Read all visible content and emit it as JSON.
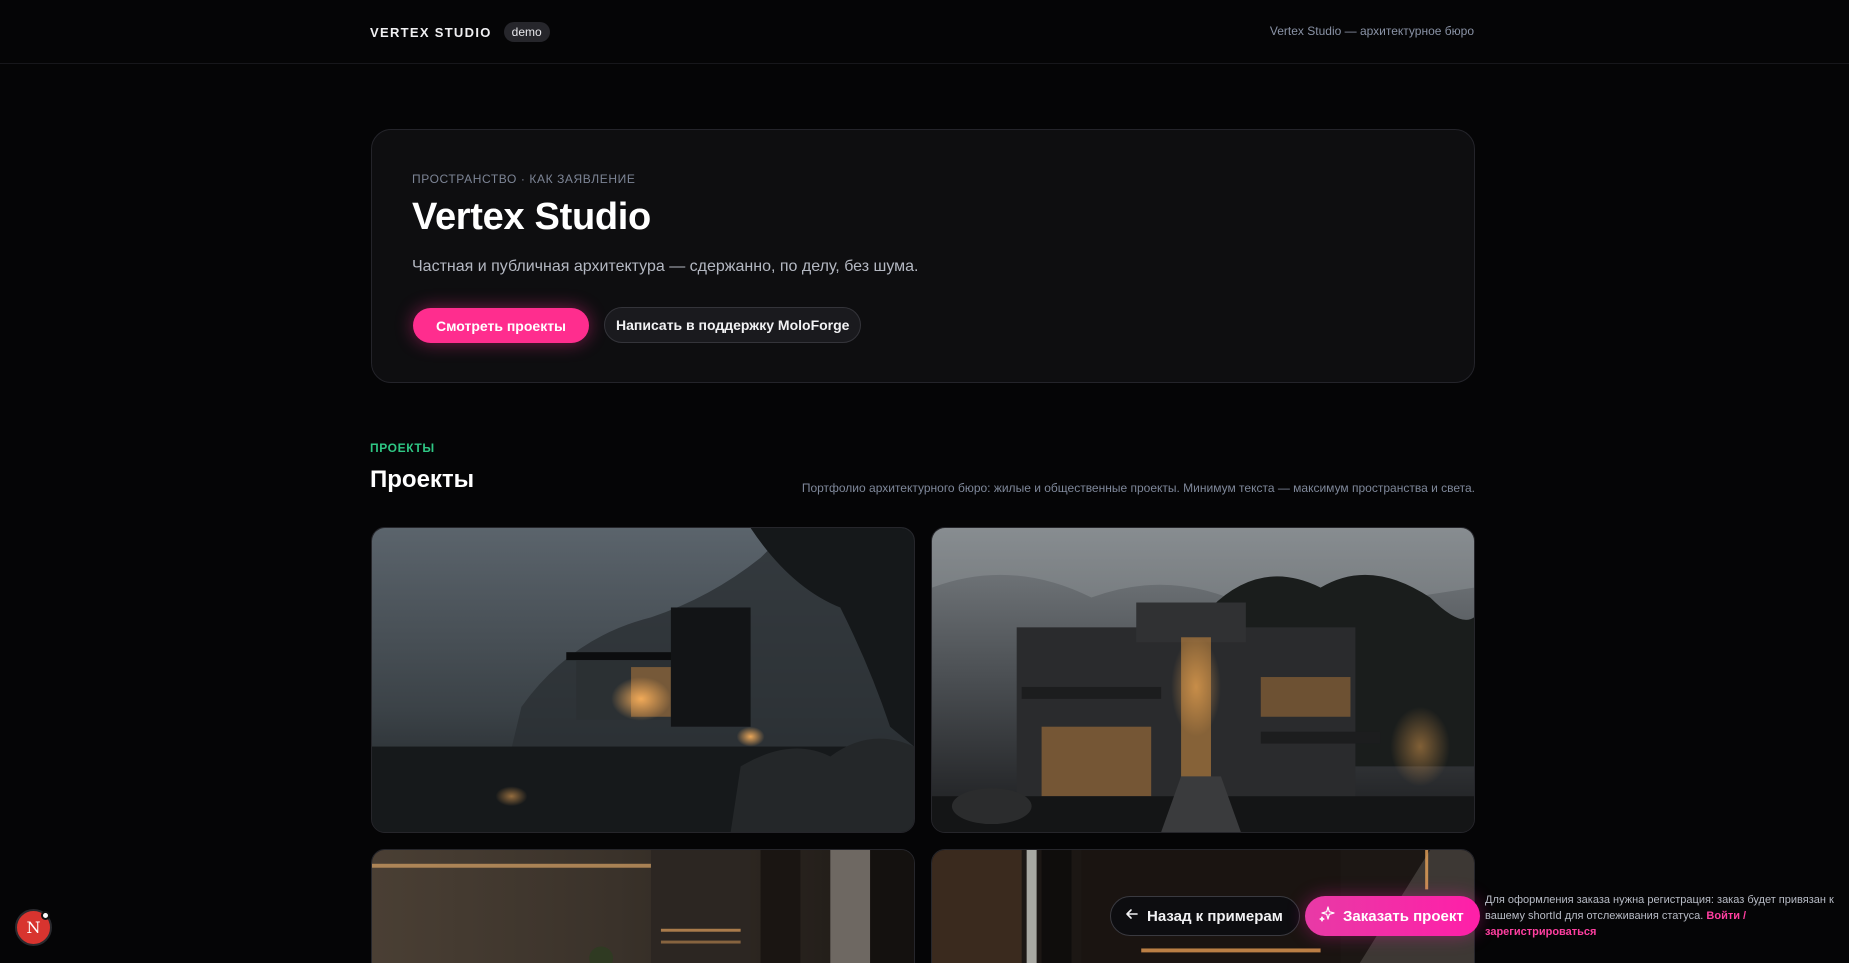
{
  "header": {
    "brand": "VERTEX STUDIO",
    "badge": "demo",
    "tagline": "Vertex Studio — архитектурное бюро"
  },
  "hero": {
    "kicker": "ПРОСТРАНСТВО · КАК ЗАЯВЛЕНИЕ",
    "title": "Vertex Studio",
    "subtitle": "Частная и публичная архитектура — сдержанно, по делу, без шума.",
    "primary_cta": "Смотреть проекты",
    "secondary_cta": "Написать в поддержку MoloForge"
  },
  "projects": {
    "kicker": "ПРОЕКТЫ",
    "title": "Проекты",
    "description": "Портфолио архитектурного бюро: жилые и общественные проекты. Минимум текста — максимум пространства и света."
  },
  "floating": {
    "avatar_letter": "N",
    "back_label": "Назад к примерам",
    "order_label": "Заказать проект",
    "note_text": "Для оформления заказа нужна регистрация: заказ будет привязан к вашему shortId для отслеживания статуса. ",
    "note_link": "Войти / зарегистрироваться"
  },
  "colors": {
    "accent": "#ff2d8e",
    "kicker_green": "#2fc784",
    "background": "#050506"
  }
}
